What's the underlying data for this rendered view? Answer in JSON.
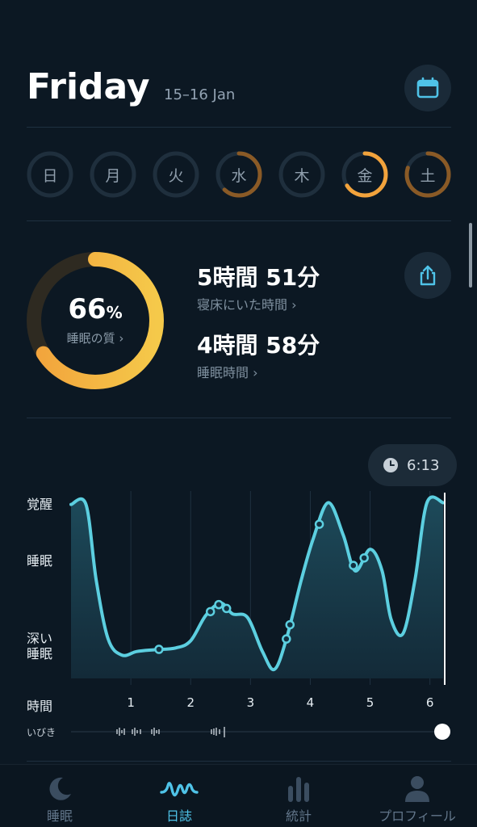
{
  "header": {
    "title": "Friday",
    "date_range": "15–16 Jan",
    "calendar_icon": "calendar-icon"
  },
  "week": {
    "days": [
      {
        "label": "日",
        "progress": 0
      },
      {
        "label": "月",
        "progress": 0
      },
      {
        "label": "火",
        "progress": 0
      },
      {
        "label": "水",
        "progress": 0.62
      },
      {
        "label": "木",
        "progress": 0
      },
      {
        "label": "金",
        "progress": 0.66,
        "selected": true
      },
      {
        "label": "土",
        "progress": 0.8
      }
    ]
  },
  "summary": {
    "quality_value": "66",
    "quality_unit": "%",
    "quality_label": "睡眠の質",
    "quality_fraction": 0.66,
    "time_in_bed": "5時間 51分",
    "time_in_bed_label": "寝床にいた時間",
    "sleep_time": "4時間 58分",
    "sleep_time_label": "睡眠時間",
    "share_icon": "share-icon"
  },
  "chart_data": {
    "type": "area",
    "end_time": "6:13",
    "y_categories": [
      "覚醒",
      "睡眠",
      "深い睡眠"
    ],
    "ylabels": {
      "awake": "覚醒",
      "sleep": "睡眠",
      "deep_1": "深い",
      "deep_2": "睡眠"
    },
    "xlabel": "時間",
    "x_ticks": [
      "1",
      "2",
      "3",
      "4",
      "5",
      "6"
    ],
    "xlim": [
      0,
      6.22
    ],
    "ylim": [
      0,
      1
    ],
    "series": [
      {
        "values": [
          [
            0,
            0.97
          ],
          [
            0.25,
            0.97
          ],
          [
            0.42,
            0.55
          ],
          [
            0.62,
            0.22
          ],
          [
            0.85,
            0.13
          ],
          [
            1.1,
            0.15
          ],
          [
            1.4,
            0.16
          ],
          [
            1.75,
            0.17
          ],
          [
            2.0,
            0.21
          ],
          [
            2.25,
            0.35
          ],
          [
            2.5,
            0.42
          ],
          [
            2.7,
            0.36
          ],
          [
            2.95,
            0.34
          ],
          [
            3.2,
            0.15
          ],
          [
            3.4,
            0.05
          ],
          [
            3.6,
            0.22
          ],
          [
            3.85,
            0.55
          ],
          [
            4.05,
            0.78
          ],
          [
            4.3,
            0.98
          ],
          [
            4.55,
            0.8
          ],
          [
            4.75,
            0.6
          ],
          [
            5.0,
            0.72
          ],
          [
            5.2,
            0.6
          ],
          [
            5.35,
            0.33
          ],
          [
            5.55,
            0.25
          ],
          [
            5.75,
            0.55
          ],
          [
            5.95,
            0.98
          ],
          [
            6.22,
            0.98
          ]
        ]
      }
    ],
    "markers": [
      1.47,
      2.33,
      2.47,
      2.6,
      3.6,
      3.66,
      4.15,
      4.72,
      4.9
    ],
    "grid": true
  },
  "snore": {
    "label": "いびき"
  },
  "tabs": [
    {
      "label": "睡眠",
      "icon": "moon-icon"
    },
    {
      "label": "日誌",
      "icon": "wave-icon",
      "active": true
    },
    {
      "label": "統計",
      "icon": "bars-icon"
    },
    {
      "label": "プロフィール",
      "icon": "person-icon"
    }
  ],
  "colors": {
    "accent": "#4fc3e8",
    "orange": "#f2a33c",
    "dark_orange": "#8a5a26",
    "background": "#0c1823"
  }
}
